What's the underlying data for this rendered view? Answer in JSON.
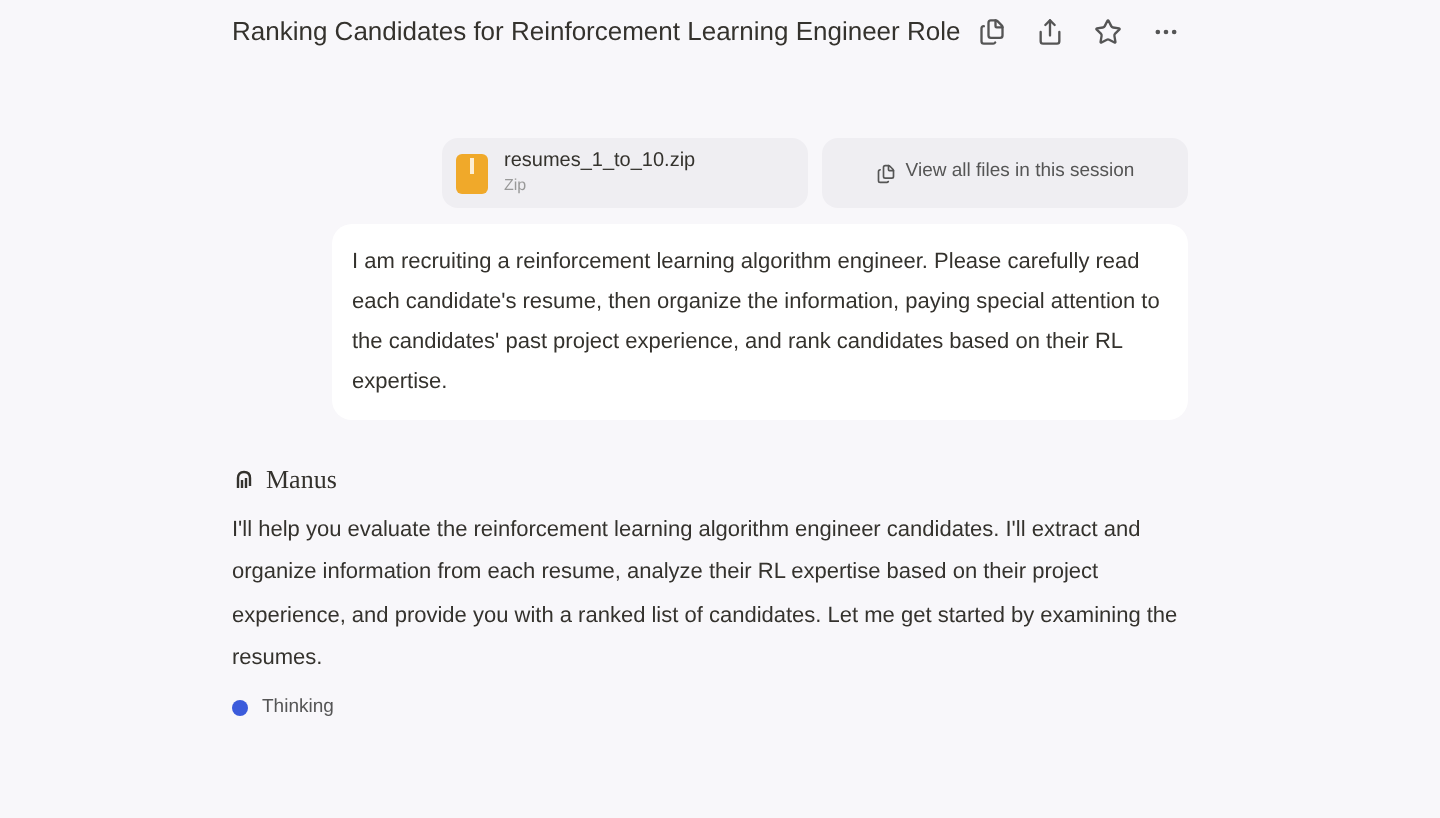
{
  "header": {
    "title": "Ranking Candidates for Reinforcement Learning Engineer Role"
  },
  "attachments": [
    {
      "kind": "file",
      "name": "resumes_1_to_10.zip",
      "type": "Zip"
    },
    {
      "kind": "link",
      "label": "View all files in this session"
    }
  ],
  "user_message": "I am recruiting a reinforcement learning algorithm engineer. Please carefully read each candidate's resume, then organize the information, paying special attention to the candidates' past project experience, and rank candidates based on their RL expertise.",
  "assistant": {
    "name": "Manus",
    "message": "I'll help you evaluate the reinforcement learning algorithm engineer candidates. I'll extract and organize information from each resume, analyze their RL expertise based on their project experience, and provide you with a ranked list of candidates. Let me get started by examining the resumes.",
    "status": "Thinking"
  }
}
